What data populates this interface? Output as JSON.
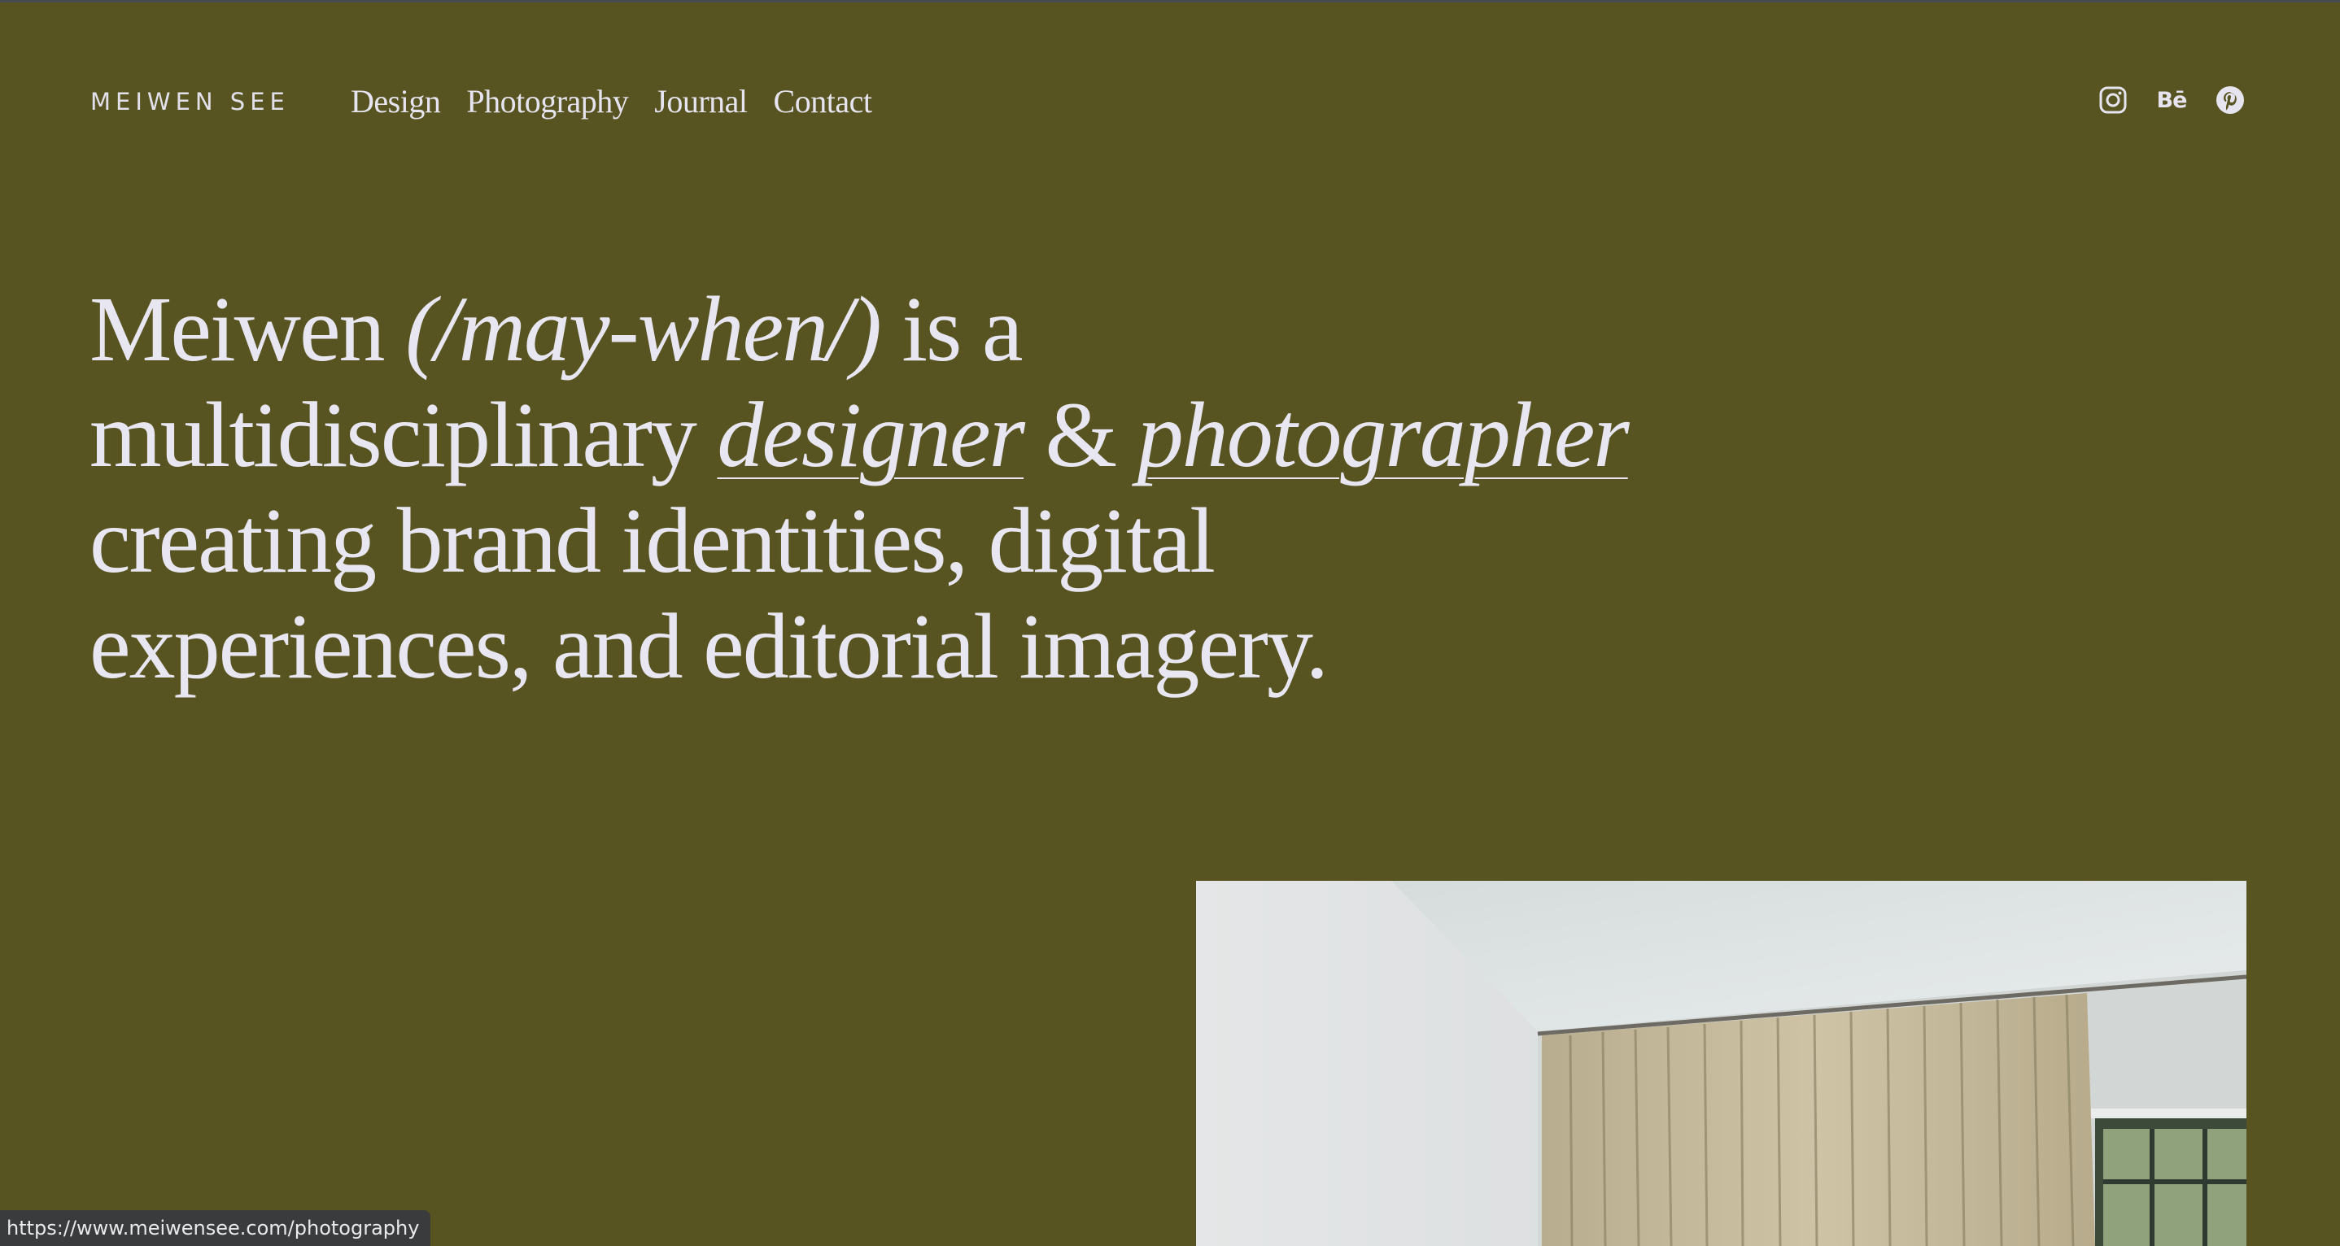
{
  "header": {
    "logo": "MEIWEN SEE",
    "nav": [
      {
        "label": "Design"
      },
      {
        "label": "Photography"
      },
      {
        "label": "Journal"
      },
      {
        "label": "Contact"
      }
    ],
    "social": [
      {
        "icon": "instagram-icon"
      },
      {
        "icon": "behance-icon",
        "label": "Bē"
      },
      {
        "icon": "pinterest-icon"
      }
    ]
  },
  "hero": {
    "name": "Meiwen",
    "pronunciation": "(/may-when/)",
    "text_1": "is a multidisciplinary",
    "designer_link": "designer",
    "amp": "&",
    "photographer_link": "photographer",
    "text_2": "creating brand identities, digital experiences, and editorial imagery."
  },
  "featured_image": {
    "description_icon": "photo-curtain-room"
  },
  "status_bar": {
    "url": "https://www.meiwensee.com/photography"
  },
  "colors": {
    "background": "#585421",
    "text": "#e6e4ee",
    "status_bar": "#3a3b3d"
  }
}
